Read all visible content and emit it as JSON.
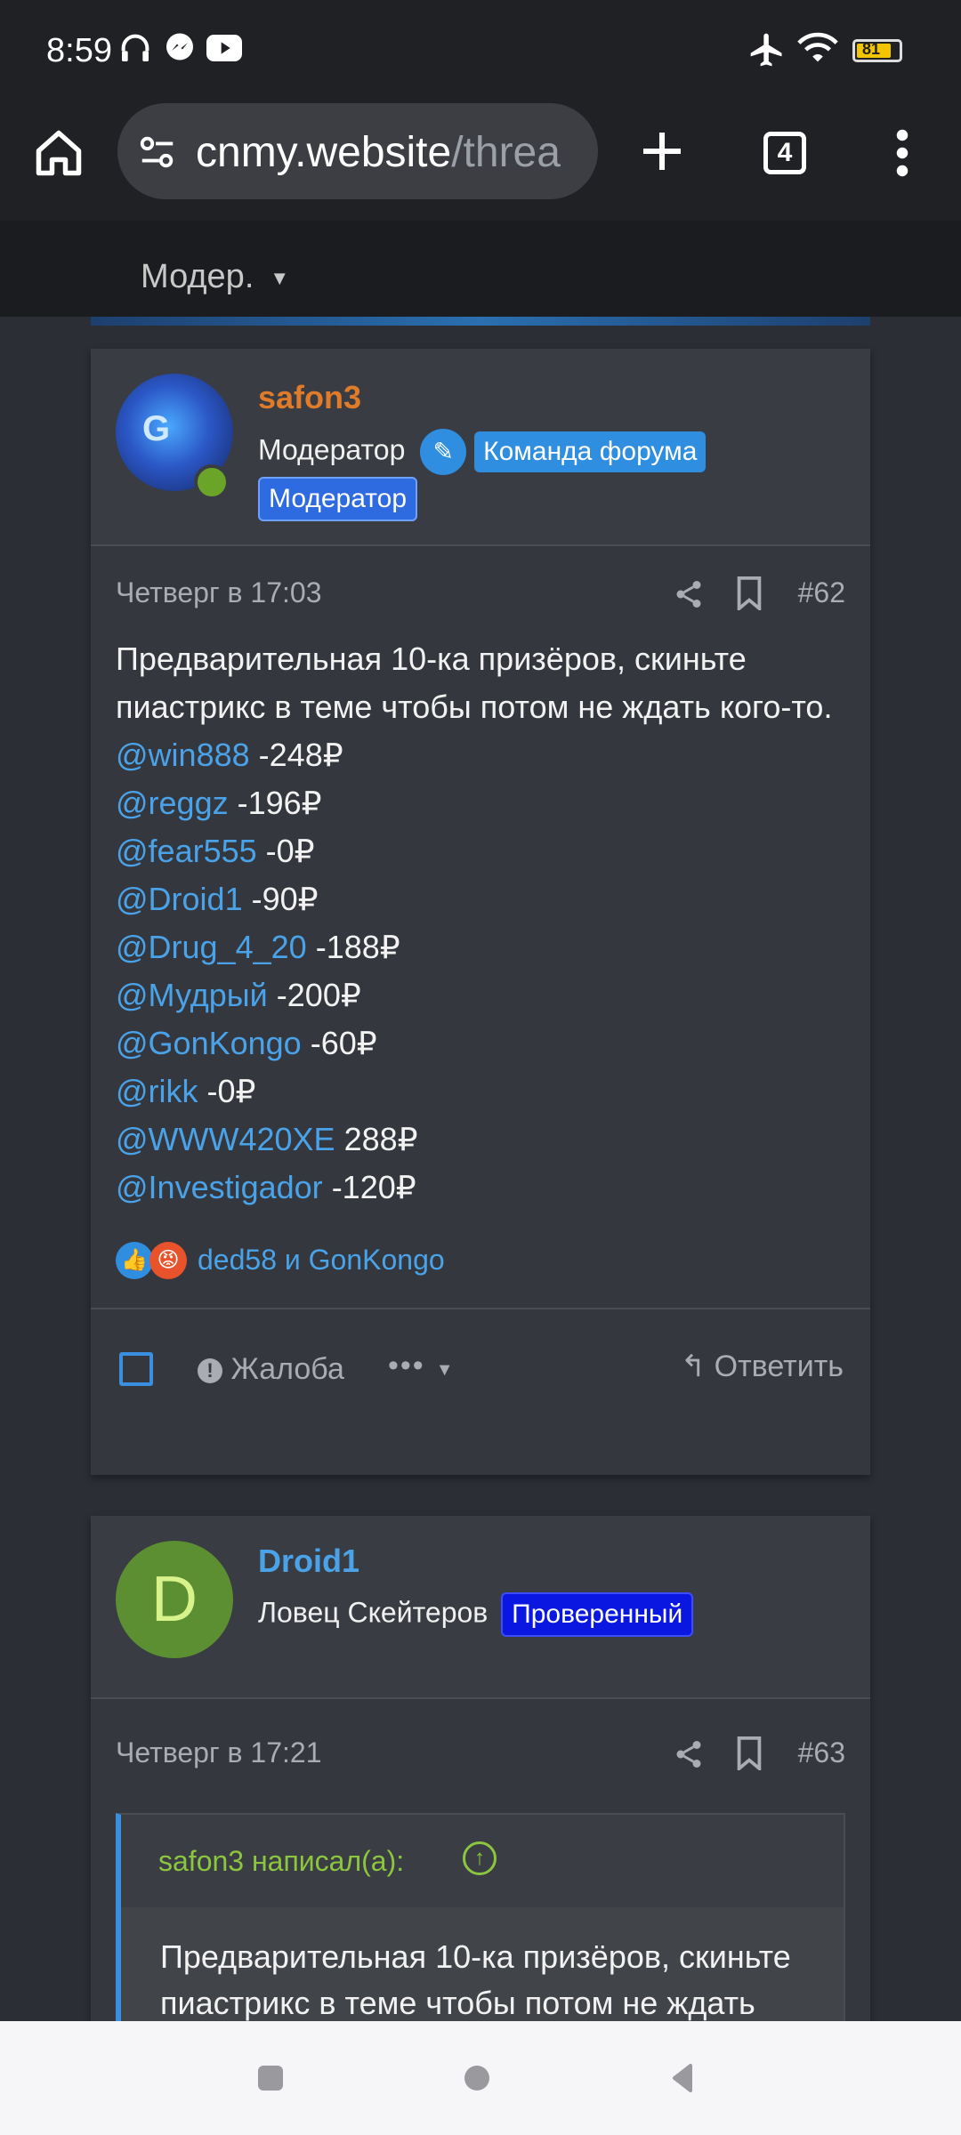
{
  "status_bar": {
    "time": "8:59",
    "battery": "81",
    "icons": [
      "headphones-icon",
      "messenger-icon",
      "youtube-icon",
      "airplane-icon",
      "wifi-icon",
      "battery-icon"
    ]
  },
  "browser": {
    "url_host": "cnmy.website",
    "url_path": "/threa",
    "tab_count": "4"
  },
  "forum_nav": {
    "menu_label": "Модер."
  },
  "posts": [
    {
      "username": "safon3",
      "username_color": "#e07b2a",
      "user_title": "Модератор",
      "badges": [
        "Команда форума",
        "Модератор"
      ],
      "date": "Четверг в 17:03",
      "number": "#62",
      "text_intro": "Предварительная 10-ка призёров, скиньте пиастрикс в теме чтобы потом не ждать кого-то.",
      "mentions": [
        {
          "user": "@win888",
          "amount": "-248₽"
        },
        {
          "user": "@reggz",
          "amount": "-196₽"
        },
        {
          "user": "@fear555",
          "amount": "-0₽"
        },
        {
          "user": "@Droid1",
          "amount": "-90₽"
        },
        {
          "user": "@Drug_4_20",
          "amount": "-188₽"
        },
        {
          "user": "@Мудрый",
          "amount": "-200₽"
        },
        {
          "user": "@GonKongo",
          "amount": "-60₽"
        },
        {
          "user": "@rikk",
          "amount": "-0₽"
        },
        {
          "user": "@WWW420XE",
          "amount": "288₽"
        },
        {
          "user": "@Investigador",
          "amount": "-120₽"
        }
      ],
      "reactions_text": "ded58 и GonKongo",
      "report_label": "Жалоба",
      "reply_label": "Ответить"
    },
    {
      "username": "Droid1",
      "username_color": "#4aa3e8",
      "avatar_letter": "D",
      "user_title": "Ловец Скейтеров",
      "badges": [
        "Проверенный"
      ],
      "date": "Четверг в 17:21",
      "number": "#63",
      "quote_author": "safon3 написал(а):",
      "quote_text": "Предварительная 10-ка призёров, скиньте пиастрикс в теме чтобы потом не ждать"
    }
  ]
}
